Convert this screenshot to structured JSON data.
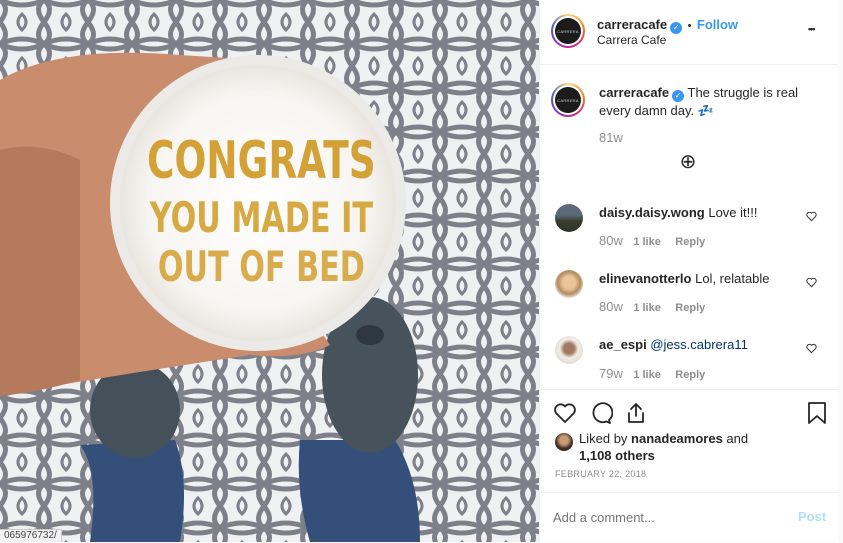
{
  "photo": {
    "cup_text_line1": "CONGRATS",
    "cup_text_line2": "YOU MADE IT",
    "cup_text_line3": "OUT OF BED"
  },
  "statusbar": {
    "text": "065976732/"
  },
  "header": {
    "avatar_text": "CARRERA",
    "username": "carreracafe",
    "verified_icon": "✓",
    "dot": "•",
    "follow_label": "Follow",
    "location": "Carrera Cafe",
    "more_icon": "•••"
  },
  "caption": {
    "username": "carreracafe",
    "text": "The struggle is real every damn day. 💤",
    "time": "81w",
    "load_more_icon": "⊕"
  },
  "comments": [
    {
      "username": "daisy.daisy.wong",
      "text": "Love it!!!",
      "time": "80w",
      "likes": "1 like",
      "reply": "Reply"
    },
    {
      "username": "elinevanotterlo",
      "text": "Lol, relatable",
      "time": "80w",
      "likes": "1 like",
      "reply": "Reply"
    },
    {
      "username": "ae_espi",
      "text": "@jess.cabrera11",
      "time": "79w",
      "likes": "1 like",
      "reply": "Reply"
    }
  ],
  "actions": {
    "liked_prefix": "Liked by ",
    "liked_user": "nanadeamores",
    "liked_and": " and",
    "liked_count": "1,108 others",
    "date": "FEBRUARY 22, 2018"
  },
  "add_comment": {
    "placeholder": "Add a comment...",
    "post_label": "Post"
  },
  "colors": {
    "link": "#3897f0",
    "muted": "#8e8e8e",
    "text": "#262626"
  }
}
